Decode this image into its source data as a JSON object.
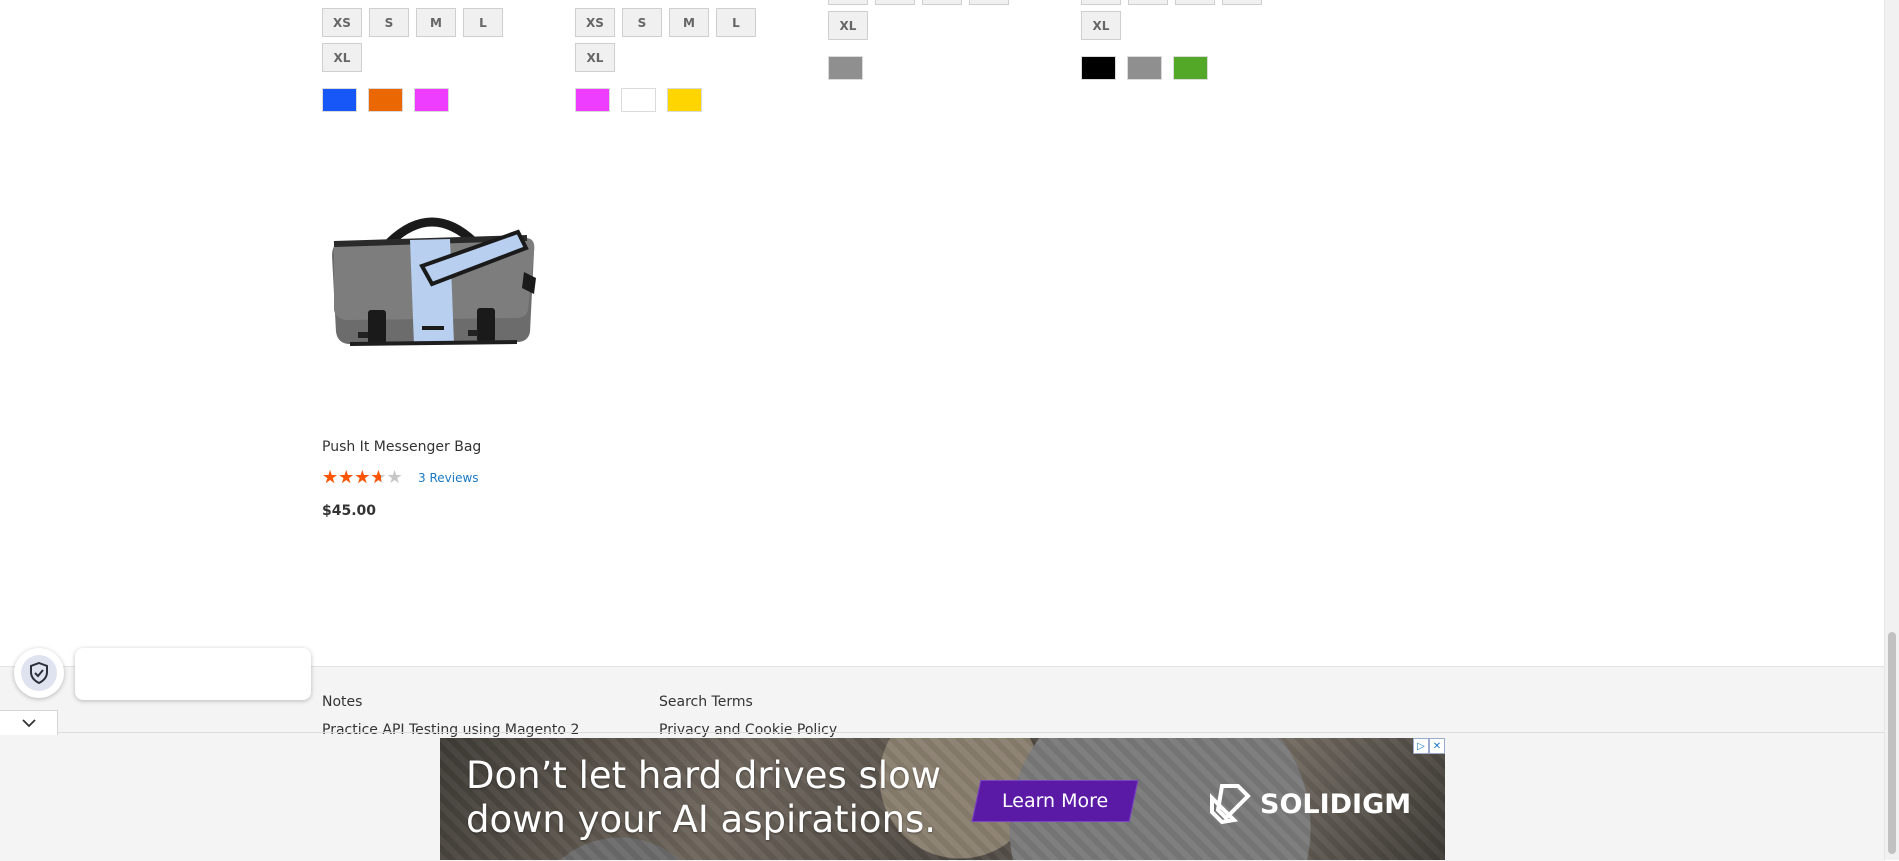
{
  "product_columns": [
    {
      "sizes_row1": [
        "XS",
        "S",
        "M",
        "L"
      ],
      "sizes_row2": [
        "XL"
      ],
      "swatches": [
        {
          "name": "Blue",
          "color": "#1857f7"
        },
        {
          "name": "Orange",
          "color": "#eb6703"
        },
        {
          "name": "Purple",
          "color": "#ef3dff"
        }
      ]
    },
    {
      "sizes_row1": [
        "XS",
        "S",
        "M",
        "L"
      ],
      "sizes_row2": [
        "XL"
      ],
      "swatches": [
        {
          "name": "Purple",
          "color": "#ef3dff"
        },
        {
          "name": "White",
          "color": "#ffffff"
        },
        {
          "name": "Yellow",
          "color": "#ffd500"
        }
      ]
    },
    {
      "sizes_row2": [
        "XL"
      ],
      "swatches": [
        {
          "name": "Gray",
          "color": "#8f8f8f"
        }
      ]
    },
    {
      "sizes_row2": [
        "XL"
      ],
      "swatches": [
        {
          "name": "Black",
          "color": "#000000"
        },
        {
          "name": "Gray",
          "color": "#8f8f8f"
        },
        {
          "name": "Green",
          "color": "#53a828"
        }
      ]
    }
  ],
  "product": {
    "name": "Push It Messenger Bag",
    "rating_percent": 65,
    "reviews_label": "3 Reviews",
    "price": "$45.00"
  },
  "footer": {
    "links_col1": [
      "Notes",
      "Practice API Testing using Magento 2"
    ],
    "links_col2": [
      "Search Terms",
      "Privacy and Cookie Policy"
    ]
  },
  "ad": {
    "headline": "Don’t let hard drives slow down your AI aspirations.",
    "cta": "Learn More",
    "brand": "SOLIDIGM",
    "brand_color": "#5b1aa6"
  },
  "icons": {
    "privacy": "shield-check-icon",
    "collapse": "chevron-down-icon"
  }
}
